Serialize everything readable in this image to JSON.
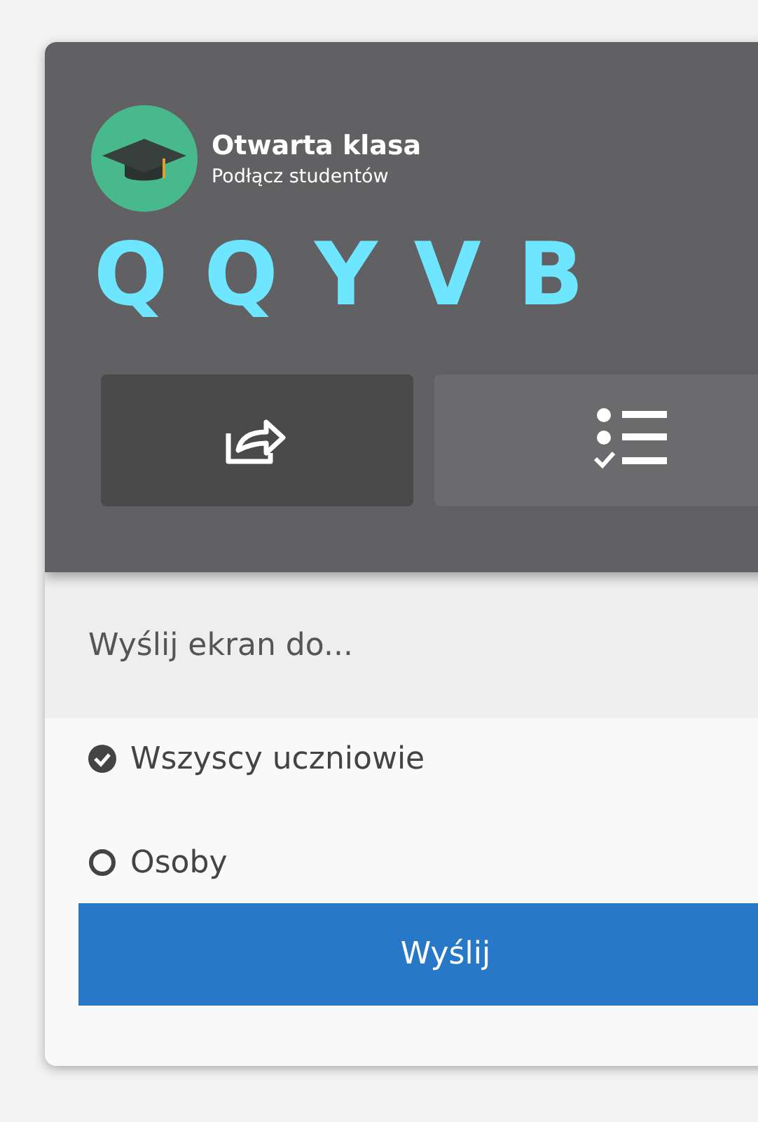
{
  "header": {
    "title": "Otwarta klasa",
    "subtitle": "Podłącz studentów",
    "code": [
      "Q",
      "Q",
      "Y",
      "V",
      "B"
    ]
  },
  "tabs": [
    {
      "kind": "share",
      "selected": true
    },
    {
      "kind": "list",
      "selected": false
    }
  ],
  "panel": {
    "heading": "Wyślij ekran do...",
    "options": [
      {
        "label": "Wszyscy uczniowie",
        "selected": true
      },
      {
        "label": "Osoby",
        "selected": false
      }
    ],
    "button": "Wyślij"
  }
}
